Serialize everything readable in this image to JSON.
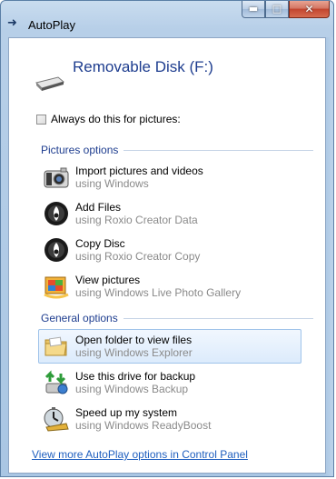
{
  "window": {
    "title": "AutoPlay"
  },
  "device": {
    "name": "Removable Disk (F:)"
  },
  "always": {
    "label": "Always do this for pictures:"
  },
  "sections": {
    "pictures": "Pictures options",
    "general": "General options"
  },
  "pictures_options": [
    {
      "label": "Import pictures and videos",
      "sub": "using Windows"
    },
    {
      "label": "Add Files",
      "sub": "using Roxio Creator Data"
    },
    {
      "label": "Copy Disc",
      "sub": "using Roxio Creator Copy"
    },
    {
      "label": "View pictures",
      "sub": "using Windows Live Photo Gallery"
    }
  ],
  "general_options": [
    {
      "label": "Open folder to view files",
      "sub": "using Windows Explorer"
    },
    {
      "label": "Use this drive for backup",
      "sub": "using Windows Backup"
    },
    {
      "label": "Speed up my system",
      "sub": "using Windows ReadyBoost"
    }
  ],
  "footer": {
    "link": "View more AutoPlay options in Control Panel"
  },
  "icons": {
    "import": "camera-icon",
    "add_files": "roxio-disc-icon",
    "copy_disc": "roxio-disc-icon",
    "view": "photo-gallery-icon",
    "open_folder": "folder-icon",
    "backup": "backup-icon",
    "speed": "readyboost-icon"
  },
  "colors": {
    "heading": "#1e3d8f",
    "link": "#1f5fbf",
    "close_button": "#c2452f",
    "selected_bg": "#dcebfc"
  }
}
